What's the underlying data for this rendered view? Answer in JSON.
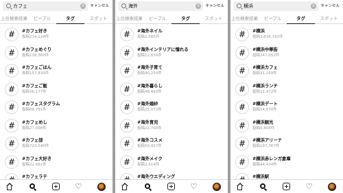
{
  "tabs": [
    "上位検索結果",
    "ピープル",
    "タグ",
    "スポット"
  ],
  "active_tab": "タグ",
  "cancel_label": "キャンセル",
  "hash_symbol": "#",
  "clear_symbol": "×",
  "heart_symbol": "♡",
  "icons": [
    "search-icon",
    "clear-icon",
    "hashtag-icon",
    "home-icon",
    "add-post-icon",
    "heart-icon",
    "profile-avatar"
  ],
  "colors": {
    "active_text": "#111111",
    "muted_text": "#999999",
    "divider": "#dbdbdb",
    "search_bg": "#efefef"
  },
  "panels": [
    {
      "query": "カフェ",
      "items": [
        {
          "name": "#カフェ好き",
          "count": "投稿214,124件"
        },
        {
          "name": "#カフェめぐり",
          "count": "投稿136,360件"
        },
        {
          "name": "#カフェごはん",
          "count": "投稿157,830件"
        },
        {
          "name": "#カフェご飯",
          "count": "投稿36,177件"
        },
        {
          "name": "#カフェスタグラム",
          "count": "投稿68,791件"
        },
        {
          "name": "#カフェめし",
          "count": "投稿27,098件"
        },
        {
          "name": "#カフェ部",
          "count": "投稿723,540件"
        },
        {
          "name": "#カフェ大好き",
          "count": "投稿22,682件"
        },
        {
          "name": "#カフェラテ",
          "count": ""
        }
      ]
    },
    {
      "query": "海外",
      "items": [
        {
          "name": "#海外ネイル",
          "count": "投稿2,585件"
        },
        {
          "name": "#海外インテリアに憧れる",
          "count": "投稿12,834件"
        },
        {
          "name": "#海外子育て",
          "count": "投稿40,254件"
        },
        {
          "name": "#海外暮らし",
          "count": "投稿48,493件"
        },
        {
          "name": "#海外婚紗",
          "count": "投稿25,072件"
        },
        {
          "name": "#海外育児",
          "count": "投稿22,760件"
        },
        {
          "name": "#海外コスメ",
          "count": "投稿50,457件"
        },
        {
          "name": "#海外メイク",
          "count": "投稿2,514件"
        },
        {
          "name": "#海外ウエディング",
          "count": ""
        }
      ]
    },
    {
      "query": "横浜",
      "items": [
        {
          "name": "#横浜",
          "count": "投稿3,634,192件"
        },
        {
          "name": "#横浜中華街",
          "count": "投稿247,052件"
        },
        {
          "name": "#横浜カフェ",
          "count": "投稿31,259件"
        },
        {
          "name": "#横浜ランチ",
          "count": "投稿11,472件"
        },
        {
          "name": "#横浜デート",
          "count": "投稿14,570件"
        },
        {
          "name": "#横浜観光",
          "count": "投稿9,808件"
        },
        {
          "name": "#横浜アリーナ",
          "count": "投稿187,767件"
        },
        {
          "name": "#横浜赤レンガ倉庫",
          "count": "投稿44,434件"
        },
        {
          "name": "#横浜駅",
          "count": ""
        }
      ]
    }
  ]
}
